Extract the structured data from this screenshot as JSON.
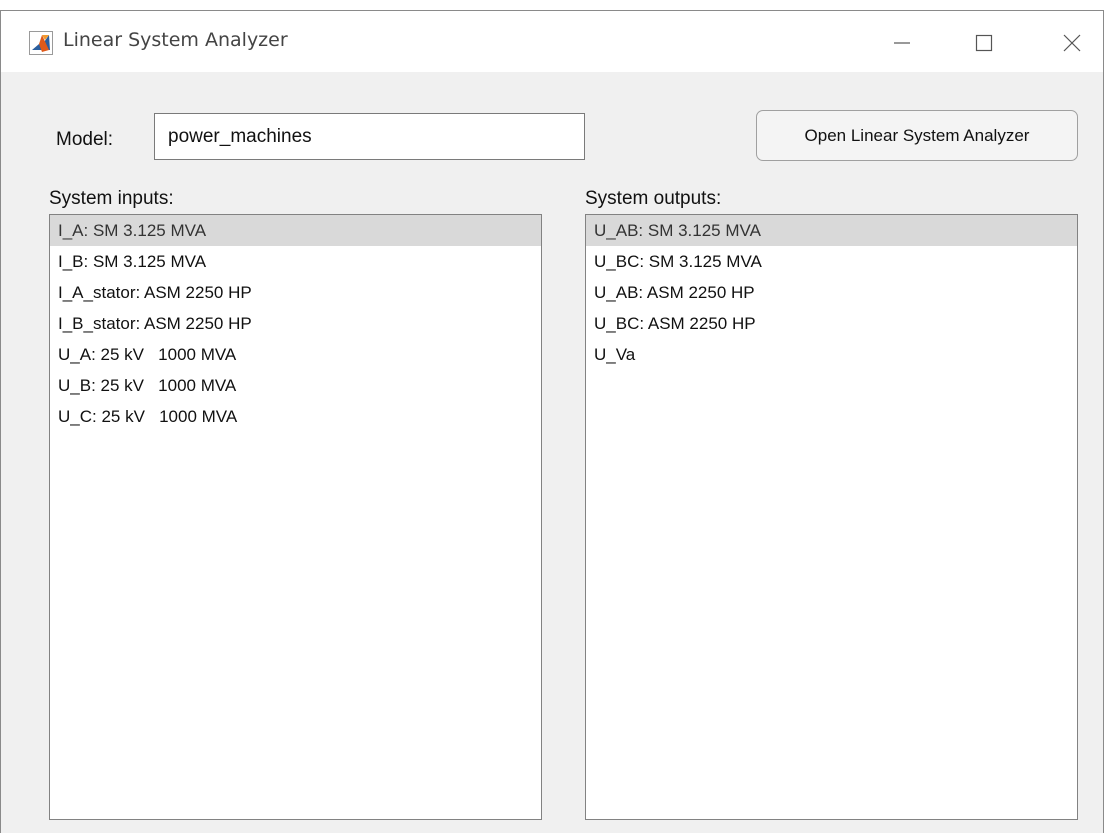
{
  "window": {
    "title": "Linear System Analyzer"
  },
  "model": {
    "label": "Model:",
    "value": "power_machines"
  },
  "open_button": {
    "label": "Open Linear System Analyzer"
  },
  "inputs": {
    "label": "System inputs:",
    "selected_index": 0,
    "items": [
      "I_A: SM 3.125 MVA",
      "I_B: SM 3.125 MVA",
      "I_A_stator: ASM 2250 HP",
      "I_B_stator: ASM 2250 HP",
      "U_A: 25 kV   1000 MVA",
      "U_B: 25 kV   1000 MVA",
      "U_C: 25 kV   1000 MVA"
    ]
  },
  "outputs": {
    "label": "System outputs:",
    "selected_index": 0,
    "items": [
      "U_AB: SM 3.125 MVA",
      "U_BC: SM 3.125 MVA",
      "U_AB: ASM 2250 HP",
      "U_BC: ASM 2250 HP",
      "U_Va"
    ]
  },
  "colors": {
    "selection": "#d9d9d9",
    "window_background": "#f0f0f0",
    "icon_orange": "#e05a1a",
    "icon_blue": "#2b5e9e"
  }
}
